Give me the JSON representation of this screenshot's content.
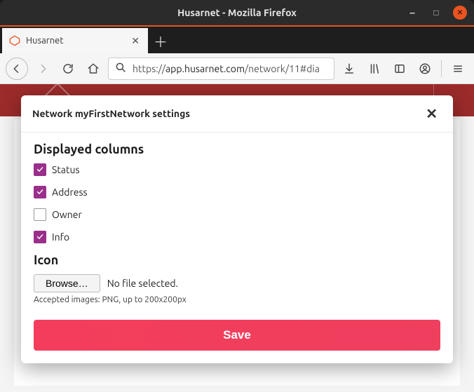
{
  "window": {
    "title": "Husarnet - Mozilla Firefox"
  },
  "tab": {
    "label": "Husarnet"
  },
  "url": {
    "scheme": "https://",
    "host": "app.husarnet.com",
    "path": "/network/11#dia"
  },
  "modal": {
    "title": "Network myFirstNetwork settings",
    "sections": {
      "columns_heading": "Displayed columns",
      "icon_heading": "Icon"
    },
    "columns": [
      {
        "label": "Status",
        "checked": true
      },
      {
        "label": "Address",
        "checked": true
      },
      {
        "label": "Owner",
        "checked": false
      },
      {
        "label": "Info",
        "checked": true
      }
    ],
    "file": {
      "browse_label": "Browse…",
      "none_label": "No file selected.",
      "hint": "Accepted images: PNG, up to 200x200px"
    },
    "save_label": "Save"
  }
}
